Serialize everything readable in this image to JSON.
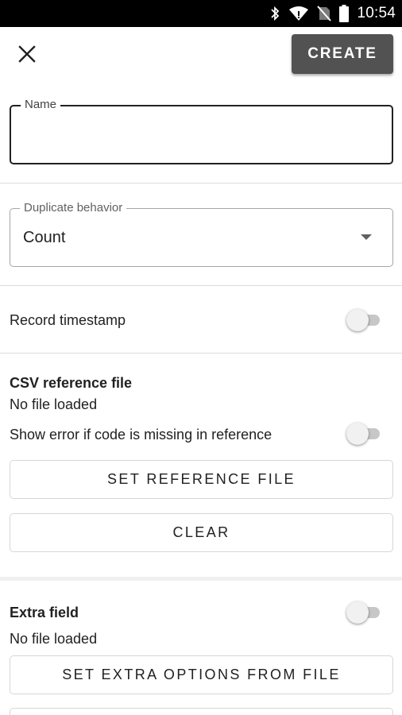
{
  "status_bar": {
    "time": "10:54",
    "icons": [
      "bluetooth-icon",
      "wifi-icon",
      "no-sim-icon",
      "battery-icon"
    ]
  },
  "app_bar": {
    "close_icon": "close-icon",
    "create_label": "CREATE"
  },
  "name_field": {
    "label": "Name",
    "value": ""
  },
  "duplicate_behavior": {
    "label": "Duplicate behavior",
    "value": "Count"
  },
  "record_timestamp": {
    "label": "Record timestamp",
    "enabled": false
  },
  "csv_reference": {
    "title": "CSV reference file",
    "status": "No file loaded",
    "show_error_label": "Show error if code is missing in reference",
    "show_error_enabled": false,
    "set_button": "SET REFERENCE FILE",
    "clear_button": "CLEAR"
  },
  "extra_field": {
    "title": "Extra field",
    "enabled": false,
    "status": "No file loaded",
    "set_button": "SET EXTRA OPTIONS FROM FILE"
  },
  "colors": {
    "status_bar_bg": "#000000",
    "primary_button_bg": "#525252",
    "switch_track_off": "#c7c7c7",
    "switch_thumb_off": "#f1f1f1"
  }
}
